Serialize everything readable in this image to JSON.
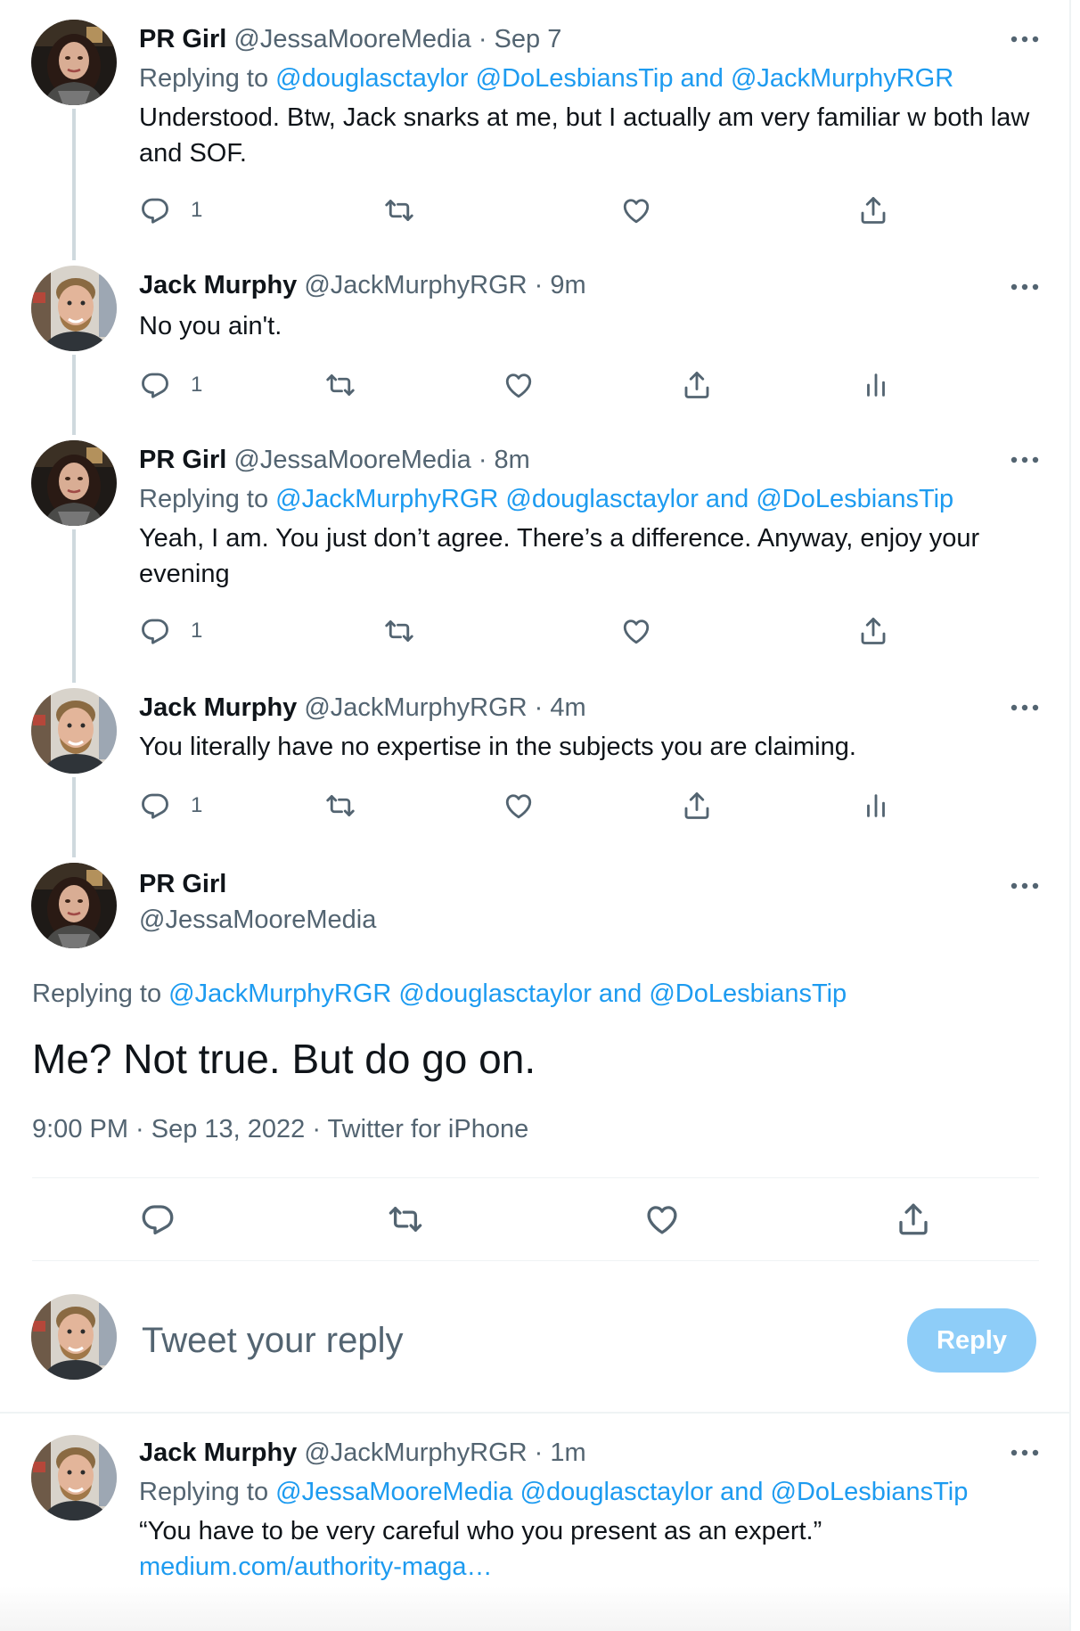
{
  "tweets": [
    {
      "name": "PR Girl",
      "handle": "@JessaMooreMedia",
      "time": "Sep 7",
      "replying_prefix": "Replying to",
      "replying_links": "@douglasctaylor @DoLesbiansTip and @JackMurphyRGR",
      "text": "Understood. Btw, Jack snarks at me, but I actually am very familiar w both law and SOF.",
      "reply_count": "1"
    },
    {
      "name": "Jack Murphy",
      "handle": "@JackMurphyRGR",
      "time": "9m",
      "text": "No you ain't.",
      "reply_count": "1"
    },
    {
      "name": "PR Girl",
      "handle": "@JessaMooreMedia",
      "time": "8m",
      "replying_prefix": "Replying to",
      "replying_links": "@JackMurphyRGR @douglasctaylor and @DoLesbiansTip",
      "text": "Yeah, I am. You just don’t agree. There’s a difference. Anyway, enjoy your evening",
      "reply_count": "1"
    },
    {
      "name": "Jack Murphy",
      "handle": "@JackMurphyRGR",
      "time": "4m",
      "text": "You literally have no expertise in the subjects you are claiming.",
      "reply_count": "1"
    }
  ],
  "main_tweet": {
    "name": "PR Girl",
    "handle": "@JessaMooreMedia",
    "replying_prefix": "Replying to",
    "replying_links": "@JackMurphyRGR @douglasctaylor and @DoLesbiansTip",
    "text": "Me? Not true. But do go on.",
    "meta": "9:00 PM · Sep 13, 2022 · Twitter for iPhone"
  },
  "composer": {
    "placeholder": "Tweet your reply",
    "button_label": "Reply"
  },
  "last_tweet": {
    "name": "Jack Murphy",
    "handle": "@JackMurphyRGR",
    "time": "1m",
    "replying_prefix": "Replying to",
    "replying_links": "@JessaMooreMedia @douglasctaylor and @DoLesbiansTip",
    "text": "“You have to be very careful who you present as an expert.”",
    "link_text": "medium.com/authority-maga…"
  },
  "colors": {
    "link": "#1d9bf0",
    "secondary": "#536471",
    "reply_button": "#8ecdf8",
    "thread_line": "#cfd9de"
  },
  "icons": [
    "reply-icon",
    "retweet-icon",
    "like-icon",
    "share-icon",
    "analytics-icon",
    "more-icon"
  ]
}
